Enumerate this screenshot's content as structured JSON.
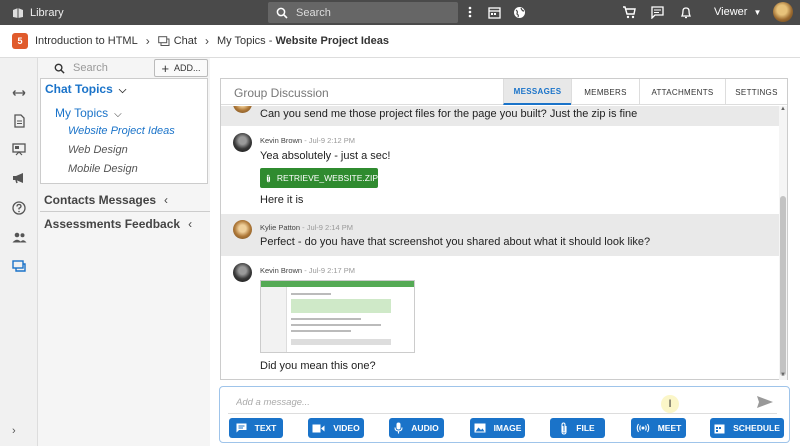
{
  "topbar": {
    "library_label": "Library",
    "search_placeholder": "Search",
    "viewer_label": "Viewer"
  },
  "breadcrumb": {
    "course": "Introduction to HTML",
    "section": "Chat",
    "topics": "My Topics",
    "separator": " - ",
    "current": "Website Project Ideas"
  },
  "sidebar": {
    "search_placeholder": "Search",
    "add_label": "ADD...",
    "chat_topics_label": "Chat Topics",
    "my_topics_label": "My Topics",
    "topics": [
      "Website Project Ideas",
      "Web Design",
      "Mobile Design"
    ],
    "contacts_label": "Contacts Messages",
    "assessments_label": "Assessments Feedback"
  },
  "conversation": {
    "title": "Group Discussion",
    "tabs": [
      "MESSAGES",
      "MEMBERS",
      "ATTACHMENTS",
      "SETTINGS"
    ],
    "active_tab": "MESSAGES",
    "messages": [
      {
        "author": "",
        "time": "",
        "text": "Can you send me those project files for the page you built? Just the zip is fine"
      },
      {
        "author": "Kevin Brown",
        "time": " - Jul-9 2:12 PM",
        "text": "Yea absolutely - just a sec!",
        "attachment": "RETRIEVE_WEBSITE.ZIP",
        "text2": "Here it is"
      },
      {
        "author": "Kylie Patton",
        "time": " - Jul-9 2:14 PM",
        "text": "Perfect - do you have that screenshot you shared about what it should look like?"
      },
      {
        "author": "Kevin Brown",
        "time": " - Jul-9 2:17 PM",
        "text": "Did you mean this one?"
      }
    ]
  },
  "compose": {
    "placeholder": "Add a message...",
    "buttons": [
      "TEXT",
      "VIDEO",
      "AUDIO",
      "IMAGE",
      "FILE",
      "MEET",
      "SCHEDULE"
    ]
  },
  "colors": {
    "accent": "#1a73c9",
    "topbar": "#4a4a4a",
    "file_chip": "#2f8b2f"
  }
}
